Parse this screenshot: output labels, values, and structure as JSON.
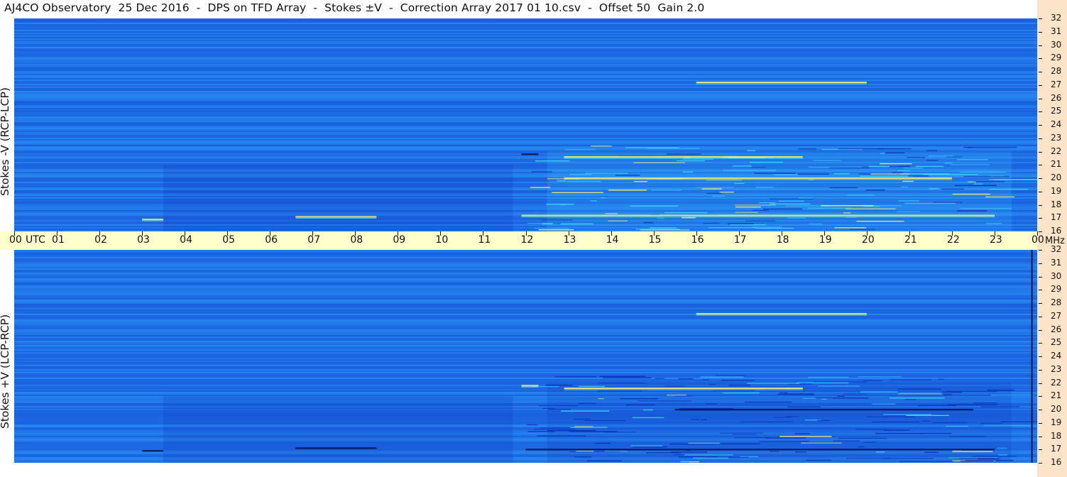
{
  "title": "AJ4CO Observatory  25 Dec 2016  -  DPS on TFD Array  -  Stokes ±V  -  Correction Array 2017 01 10.csv  -  Offset 50  Gain 2.0",
  "panels": {
    "top": {
      "ylabel": "Stokes -V  (RCP-LCP)"
    },
    "bottom": {
      "ylabel": "Stokes +V  (LCP-RCP)"
    }
  },
  "time_axis": {
    "first_label": "00",
    "utc_label": "UTC",
    "unit_label": "MHz",
    "ticks": [
      "00",
      "01",
      "02",
      "03",
      "04",
      "05",
      "06",
      "07",
      "08",
      "09",
      "10",
      "11",
      "12",
      "13",
      "14",
      "15",
      "16",
      "17",
      "18",
      "19",
      "20",
      "21",
      "22",
      "23",
      "00"
    ]
  },
  "colors": {
    "background_blue": "#1f6fe8",
    "dark_blue": "#0b2fb8",
    "cyan": "#3ed6ff",
    "yellow": "#fff06a",
    "axis_band": "#ffffcc",
    "right_strip": "#fde3c8"
  },
  "chart_data": [
    {
      "type": "heatmap",
      "name": "Stokes -V  (RCP-LCP)",
      "x_range_utc_hours": [
        0,
        24
      ],
      "y_range_mhz": [
        16,
        32
      ],
      "y_ticks": [
        16,
        17,
        18,
        19,
        20,
        21,
        22,
        23,
        24,
        25,
        26,
        27,
        28,
        29,
        30,
        31,
        32
      ],
      "features": [
        {
          "kind": "bright",
          "t0": 11.9,
          "t1": 23.0,
          "f": 17.2
        },
        {
          "kind": "bright",
          "t0": 6.6,
          "t1": 8.5,
          "f": 17.1
        },
        {
          "kind": "bright",
          "t0": 12.9,
          "t1": 22.0,
          "f": 20.0
        },
        {
          "kind": "bright",
          "t0": 12.9,
          "t1": 18.5,
          "f": 21.6
        },
        {
          "kind": "bright",
          "t0": 16.0,
          "t1": 20.0,
          "f": 27.2
        },
        {
          "kind": "dark",
          "t0": 11.9,
          "t1": 12.3,
          "f": 21.8
        },
        {
          "kind": "bright",
          "t0": 3.0,
          "t1": 3.5,
          "f": 16.9
        }
      ]
    },
    {
      "type": "heatmap",
      "name": "Stokes +V  (LCP-RCP)",
      "x_range_utc_hours": [
        0,
        24
      ],
      "y_range_mhz": [
        16,
        32
      ],
      "y_ticks": [
        16,
        17,
        18,
        19,
        20,
        21,
        22,
        23,
        24,
        25,
        26,
        27,
        28,
        29,
        30,
        31,
        32
      ],
      "features": [
        {
          "kind": "dark",
          "t0": 12.0,
          "t1": 23.0,
          "f": 17.0
        },
        {
          "kind": "dark",
          "t0": 6.6,
          "t1": 8.5,
          "f": 17.1
        },
        {
          "kind": "dark",
          "t0": 15.5,
          "t1": 22.5,
          "f": 20.0
        },
        {
          "kind": "bright",
          "t0": 12.9,
          "t1": 18.5,
          "f": 21.6
        },
        {
          "kind": "bright",
          "t0": 16.0,
          "t1": 20.0,
          "f": 27.2
        },
        {
          "kind": "bright",
          "t0": 11.9,
          "t1": 12.3,
          "f": 21.8
        },
        {
          "kind": "dark",
          "t0": 3.0,
          "t1": 3.5,
          "f": 16.9
        }
      ]
    }
  ]
}
